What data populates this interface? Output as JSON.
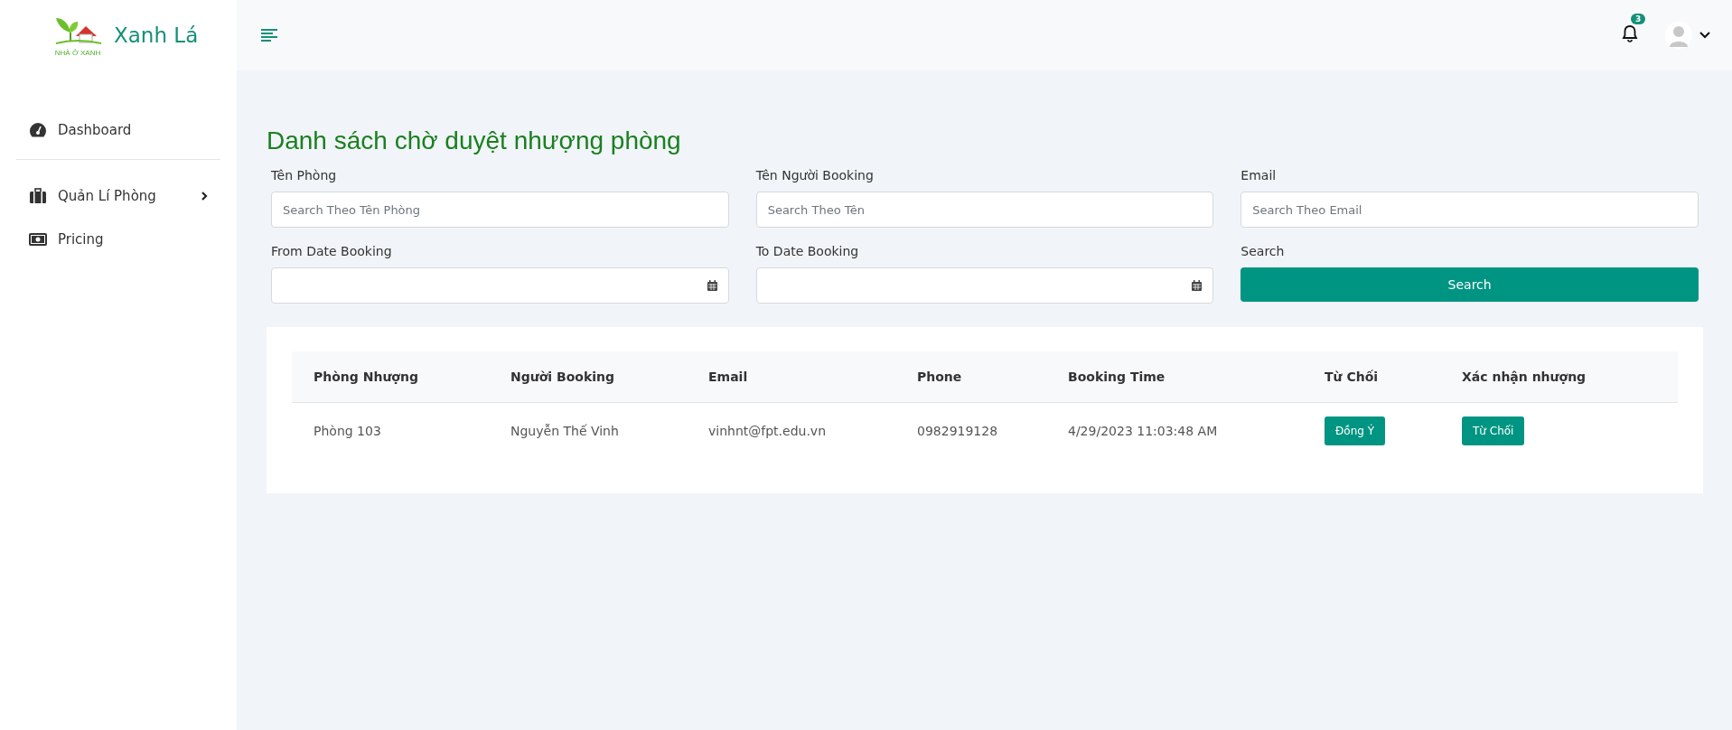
{
  "brand": {
    "name": "Xanh Lá",
    "logo_caption": "NHÀ Ở XANH"
  },
  "sidebar": {
    "items": [
      {
        "label": "Dashboard",
        "expandable": false
      },
      {
        "label": "Quản Lí Phòng",
        "expandable": true
      },
      {
        "label": "Pricing",
        "expandable": false
      }
    ]
  },
  "header": {
    "notification_count": "3"
  },
  "page_title": "Danh sách chờ duyệt nhượng phòng",
  "filters": [
    {
      "label": "Tên Phòng",
      "kind": "text",
      "placeholder": "Search Theo Tên Phòng"
    },
    {
      "label": "Tên Người Booking",
      "kind": "text",
      "placeholder": "Search Theo Tên"
    },
    {
      "label": "Email",
      "kind": "text",
      "placeholder": "Search Theo Email"
    },
    {
      "label": "From Date Booking",
      "kind": "date"
    },
    {
      "label": "To Date Booking",
      "kind": "date"
    },
    {
      "label": "Search",
      "kind": "button",
      "button": "Search"
    }
  ],
  "table": {
    "columns": [
      "Phòng Nhượng",
      "Người Booking",
      "Email",
      "Phone",
      "Booking Time",
      "Từ Chối",
      "Xác nhận nhượng"
    ],
    "rows": [
      {
        "cells": [
          "Phòng 103",
          "Nguyễn Thế Vinh",
          "vinhnt@fpt.edu.vn",
          "0982919128",
          "4/29/2023 11:03:48 AM"
        ],
        "accept": "Đồng Ý",
        "reject": "Từ Chối"
      }
    ]
  }
}
